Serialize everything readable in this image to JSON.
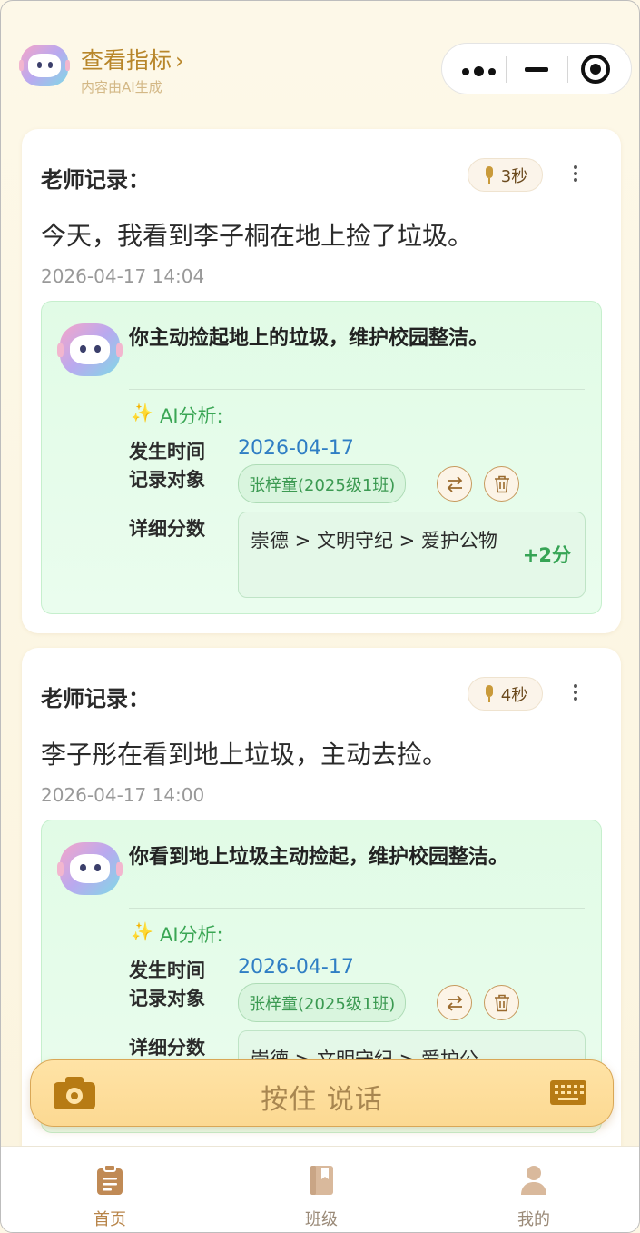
{
  "header": {
    "title": "查看指标",
    "title_chevron": "›",
    "subtitle": "内容由AI生成"
  },
  "colors": {
    "brand_gold": "#b8862a",
    "ai_green": "#3aa654",
    "date_blue": "#2f7ec4",
    "voice_bar": "#fcd992"
  },
  "records": [
    {
      "label": "老师记录：",
      "voice_duration": "3秒",
      "text": "今天，我看到李子桐在地上捡了垃圾。",
      "timestamp": "2026-04-17 14:04",
      "ai": {
        "summary": "你主动捡起地上的垃圾，维护校园整洁。",
        "spark": "✨",
        "label": "AI分析:",
        "time_key": "发生时间",
        "time_value": "2026-04-17",
        "target_key": "记录对象",
        "target_value": "张梓童(2025级1班)",
        "detail_key": "详细分数",
        "detail_path": "崇德 > 文明守纪 > 爱护公物",
        "detail_score": "+2分"
      }
    },
    {
      "label": "老师记录：",
      "voice_duration": "4秒",
      "text": "李子彤在看到地上垃圾，主动去捡。",
      "timestamp": "2026-04-17 14:00",
      "ai": {
        "summary": "你看到地上垃圾主动捡起，维护校园整洁。",
        "spark": "✨",
        "label": "AI分析:",
        "time_key": "发生时间",
        "time_value": "2026-04-17",
        "target_key": "记录对象",
        "target_value": "张梓童(2025级1班)",
        "detail_key": "详细分数",
        "detail_path": "崇德 > 文明守纪 > 爱护公",
        "detail_score": ""
      }
    }
  ],
  "voice_bar": {
    "label": "按住 说话",
    "left_icon": "camera-icon",
    "right_icon": "keyboard-icon"
  },
  "tabs": [
    {
      "label": "首页",
      "icon": "clipboard-icon",
      "active": true
    },
    {
      "label": "班级",
      "icon": "book-icon",
      "active": false
    },
    {
      "label": "我的",
      "icon": "person-icon",
      "active": false
    }
  ]
}
